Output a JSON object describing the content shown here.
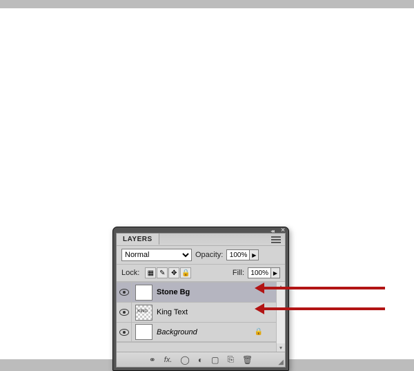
{
  "panel": {
    "title": "LAYERS",
    "blend_mode": "Normal",
    "opacity_label": "Opacity:",
    "opacity_value": "100%",
    "lock_label": "Lock:",
    "fill_label": "Fill:",
    "fill_value": "100%"
  },
  "lock_icons": {
    "transparent": "▦",
    "pixels": "✎",
    "position": "✥",
    "all": "🔒"
  },
  "layers": [
    {
      "name": "Stone Bg",
      "style": "bold",
      "selected": true,
      "thumb": "white",
      "locked": false
    },
    {
      "name": "King Text",
      "style": "normal",
      "selected": false,
      "thumb": "checker",
      "thumb_text": "KING",
      "locked": false
    },
    {
      "name": "Background",
      "style": "italic",
      "selected": false,
      "thumb": "white",
      "locked": true
    }
  ],
  "footer_icons": {
    "link": "⚭",
    "fx": "fx.",
    "mask": "◯",
    "adjust": "◐",
    "group": "▢",
    "new": "⎘",
    "trash": "🗑"
  }
}
